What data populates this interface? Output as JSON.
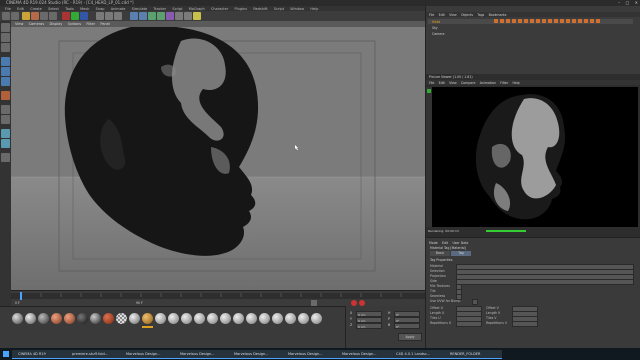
{
  "window": {
    "title": "CINEMA 4D R19.024 Studio (RC - R19) - [C4_HEAD_LP_01.c4d *]",
    "controls": [
      "–",
      "□",
      "✕"
    ]
  },
  "menubar": {
    "items": [
      "File",
      "Edit",
      "Create",
      "Select",
      "Tools",
      "Mesh",
      "Snap",
      "Animate",
      "Simulate",
      "Tracker",
      "Script",
      "MoGraph",
      "Character",
      "Plugins",
      "Redshift",
      "Script",
      "Window",
      "Help"
    ]
  },
  "viewport": {
    "menu": [
      "View",
      "Cameras",
      "Display",
      "Options",
      "Filter",
      "Panel"
    ]
  },
  "picture_viewer": {
    "title": "Picture Viewer (1.00 / 1.81)",
    "menu": [
      "File",
      "Edit",
      "View",
      "Compare",
      "Animation",
      "Filter",
      "Help"
    ],
    "status": "Rendering: 00:00:13"
  },
  "object_manager": {
    "menu": [
      "File",
      "Edit",
      "View",
      "Objects",
      "Tags",
      "Bookmarks"
    ],
    "objects": [
      "Head",
      "Sky",
      "Camera"
    ]
  },
  "attribute_manager": {
    "menu": [
      "Mode",
      "Edit",
      "User Data"
    ],
    "header": "Material Tag [Material]",
    "tabs": [
      "Basic",
      "Tag"
    ],
    "section": "Tag Properties",
    "rows": [
      "Material",
      "Selection",
      "Projection",
      "Side",
      "Mix Textures",
      "Tile",
      "Seamless",
      "Use UVW for Bump",
      "Offset U",
      "Offset V",
      "Length U",
      "Length V",
      "Tiles U",
      "Tiles V",
      "Repetitions U",
      "Repetitions V"
    ]
  },
  "coordinates": {
    "labels": [
      "X",
      "Y",
      "Z",
      "H",
      "P",
      "B"
    ],
    "values": [
      "0 cm",
      "0 cm",
      "0 cm",
      "0°",
      "0°",
      "0°"
    ],
    "apply_label": "Apply"
  },
  "timeline": {
    "start": "0 F",
    "end": "90 F"
  },
  "taskbar": {
    "items": [
      "CINEMA 4D R19",
      "premiere-stuff-fold...",
      "Marvelous Design...",
      "Marvelous Design...",
      "Marvelous Design...",
      "Marvelous Design...",
      "Marvelous Design...",
      "C4D 4.0.1 Landsc...",
      "RENDER_FOLDER"
    ]
  },
  "colors": {
    "viewport_bg": "#7b7b7b",
    "accent": "#4aa3ff",
    "render_bg": "#000000"
  }
}
